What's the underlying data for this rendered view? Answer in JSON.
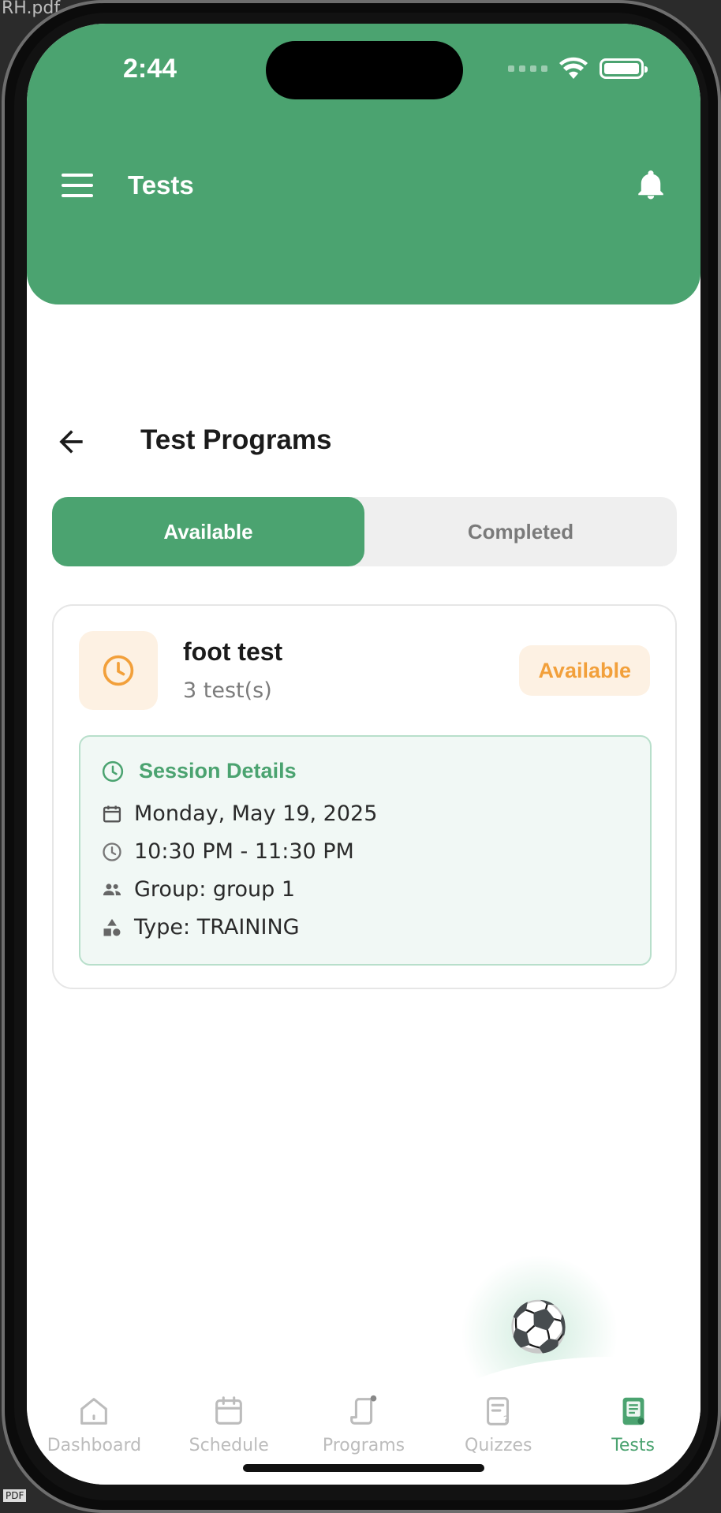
{
  "desk": {
    "file_label": "RH.pdf",
    "pdf_tag": "PDF"
  },
  "status_bar": {
    "time": "2:44"
  },
  "header": {
    "title": "Tests",
    "menu_icon": "hamburger-menu-icon",
    "bell_icon": "bell-icon"
  },
  "page": {
    "title": "Test Programs",
    "back_icon": "arrow-left-icon"
  },
  "tabs": [
    {
      "label": "Available",
      "active": true
    },
    {
      "label": "Completed",
      "active": false
    }
  ],
  "card": {
    "icon": "clock-icon",
    "title": "foot test",
    "subtitle": "3 test(s)",
    "badge": "Available",
    "session": {
      "heading": "Session Details",
      "date": "Monday, May 19, 2025",
      "time_range": "10:30 PM - 11:30 PM",
      "group": "Group: group 1",
      "type": "Type: TRAINING"
    }
  },
  "fab": {
    "icon": "soccer-ball-icon",
    "glyph": "⚽"
  },
  "bottom_nav": [
    {
      "label": "Dashboard",
      "icon": "home-icon",
      "active": false
    },
    {
      "label": "Schedule",
      "icon": "calendar-icon",
      "active": false
    },
    {
      "label": "Programs",
      "icon": "programs-scroll-icon",
      "active": false
    },
    {
      "label": "Quizzes",
      "icon": "quiz-icon",
      "active": false
    },
    {
      "label": "Tests",
      "icon": "tests-document-icon",
      "active": true
    }
  ],
  "colors": {
    "primary": "#4ba370",
    "accent_orange": "#f2a03b",
    "badge_bg": "#fdf1e3",
    "session_bg": "#f1f8f5"
  }
}
